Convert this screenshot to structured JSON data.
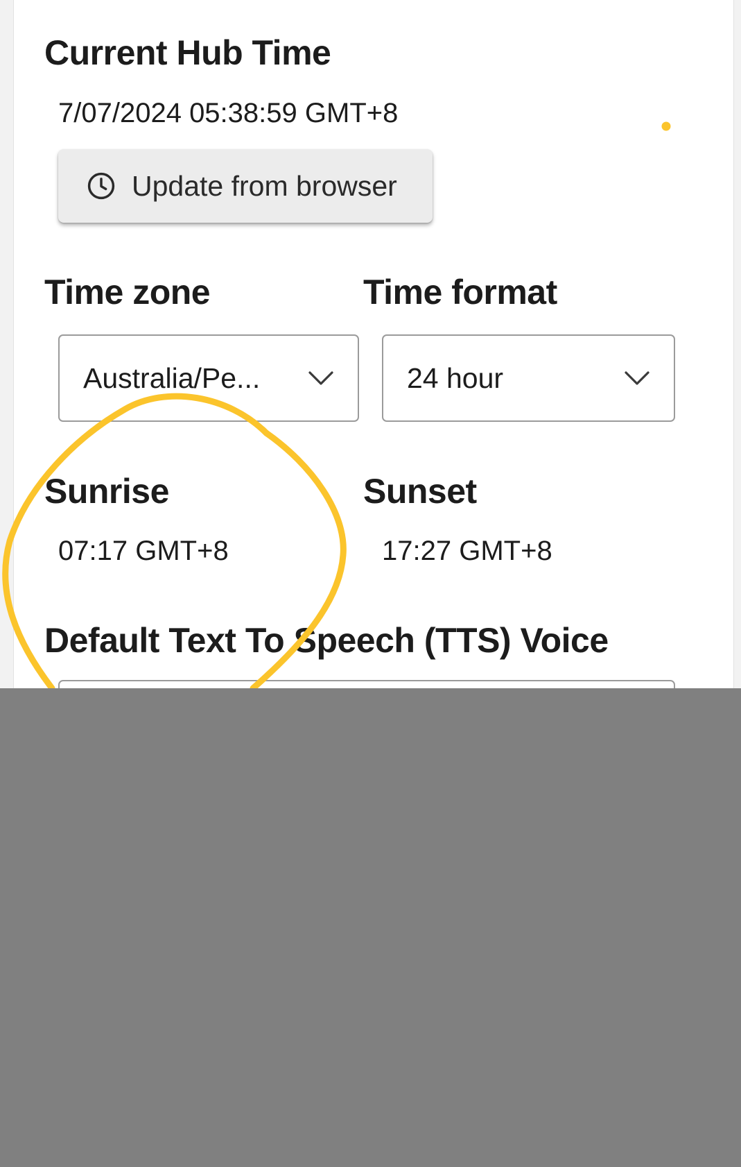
{
  "hub_time": {
    "heading": "Current Hub Time",
    "value": "7/07/2024 05:38:59 GMT+8",
    "update_button_label": "Update from browser"
  },
  "time_zone": {
    "heading": "Time zone",
    "selected": "Australia/Pe..."
  },
  "time_format": {
    "heading": "Time format",
    "selected": "24 hour"
  },
  "sunrise": {
    "heading": "Sunrise",
    "value": "07:17 GMT+8"
  },
  "sunset": {
    "heading": "Sunset",
    "value": "17:27 GMT+8"
  },
  "tts": {
    "heading": "Default Text To Speech (TTS) Voice"
  },
  "colors": {
    "annotation": "#fbc42c",
    "overlay": "#808080"
  },
  "icons": {
    "update_button": "clock-icon",
    "dropdown": "chevron-down-icon"
  }
}
